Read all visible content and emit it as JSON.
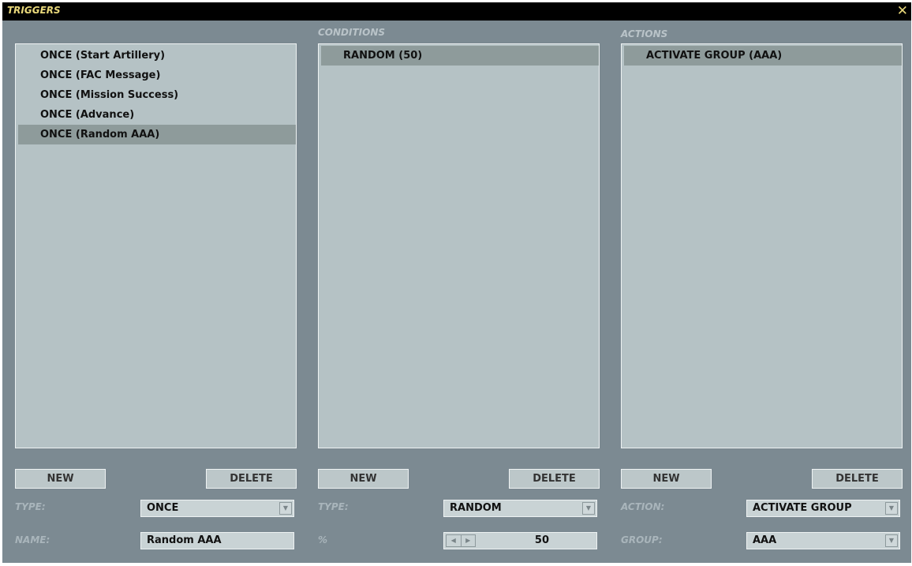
{
  "window": {
    "title": "TRIGGERS",
    "close_glyph": "✕",
    "close_icon": "close-icon"
  },
  "triggers": {
    "items": [
      "ONCE (Start Artillery)",
      "ONCE (FAC Message)",
      "ONCE (Mission Success)",
      "ONCE (Advance)",
      "ONCE (Random AAA)"
    ],
    "selected_index": 4,
    "new_label": "NEW",
    "delete_label": "DELETE",
    "type_label": "TYPE:",
    "type_value": "ONCE",
    "name_label": "NAME:",
    "name_value": "Random AAA"
  },
  "conditions": {
    "header": "CONDITIONS",
    "items": [
      "RANDOM (50)"
    ],
    "selected_index": 0,
    "new_label": "NEW",
    "delete_label": "DELETE",
    "type_label": "TYPE:",
    "type_value": "RANDOM",
    "percent_label": "%",
    "percent_value": "50"
  },
  "actions": {
    "header": "ACTIONS",
    "items": [
      "ACTIVATE GROUP (AAA)"
    ],
    "selected_index": 0,
    "new_label": "NEW",
    "delete_label": "DELETE",
    "action_label": "ACTION:",
    "action_value": "ACTIVATE GROUP",
    "group_label": "GROUP:",
    "group_value": "AAA"
  },
  "colors": {
    "title_accent": "#e8d77a",
    "panel_bg": "#7c8a92",
    "list_bg": "#b5c2c5",
    "selection": "#8e9b9b"
  }
}
